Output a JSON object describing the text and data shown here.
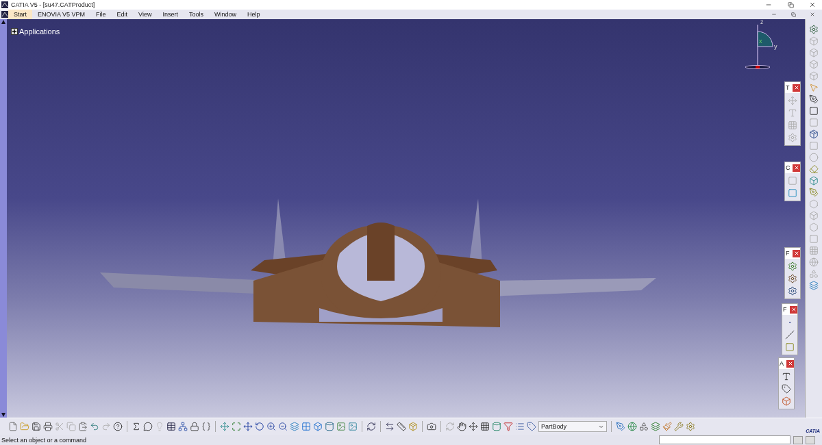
{
  "window": {
    "title": "CATIA V5 - [su47.CATProduct]"
  },
  "menu": [
    {
      "label": "Start",
      "selected": true
    },
    {
      "label": "ENOVIA V5 VPM",
      "selected": false
    },
    {
      "label": "File",
      "selected": false
    },
    {
      "label": "Edit",
      "selected": false
    },
    {
      "label": "View",
      "selected": false
    },
    {
      "label": "Insert",
      "selected": false
    },
    {
      "label": "Tools",
      "selected": false
    },
    {
      "label": "Window",
      "selected": false
    },
    {
      "label": "Help",
      "selected": false
    }
  ],
  "tree": {
    "items": [
      {
        "label": "Applications",
        "expanded": false
      }
    ]
  },
  "floating_toolbars": [
    {
      "title": "T"
    },
    {
      "title": "C"
    },
    {
      "title": "F"
    },
    {
      "title": "F"
    },
    {
      "title": "A"
    }
  ],
  "compass": {
    "axes": [
      "z",
      "x",
      "y"
    ]
  },
  "body_selector": {
    "value": "PartBody"
  },
  "logo": {
    "text": "CATIA"
  },
  "status_bar": {
    "message": "Select an object or a command"
  }
}
